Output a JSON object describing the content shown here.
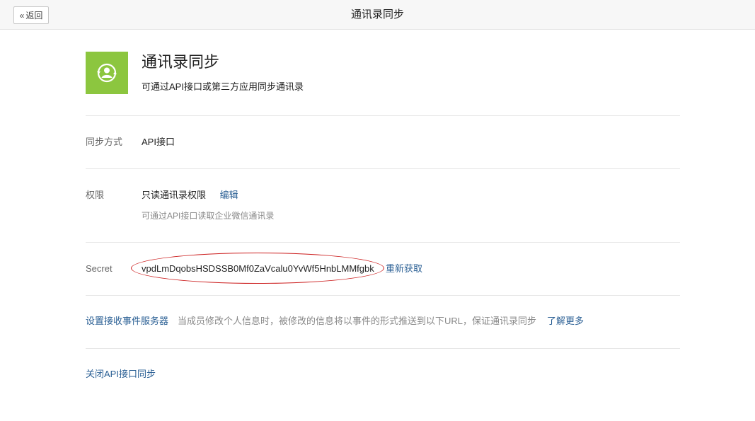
{
  "header": {
    "back_label": "返回",
    "title": "通讯录同步"
  },
  "app": {
    "icon": "contacts-sync-icon",
    "icon_color": "#8cc63f",
    "title": "通讯录同步",
    "description": "可通过API接口或第三方应用同步通讯录"
  },
  "sync_method": {
    "label": "同步方式",
    "value": "API接口"
  },
  "permission": {
    "label": "权限",
    "value": "只读通讯录权限",
    "edit_label": "编辑",
    "note": "可通过API接口读取企业微信通讯录"
  },
  "secret": {
    "label": "Secret",
    "value": "vpdLmDqobsHSDSSB0Mf0ZaVcalu0YvWf5HnbLMMfgbk",
    "refresh_label": "重新获取",
    "highlight_color": "#cc1f1f"
  },
  "event_server": {
    "link_label": "设置接收事件服务器",
    "description": "当成员修改个人信息时，被修改的信息将以事件的形式推送到以下URL，保证通讯录同步",
    "more_label": "了解更多"
  },
  "close_sync": {
    "label": "关闭API接口同步"
  },
  "colors": {
    "link": "#2a5f94",
    "muted": "#888888"
  }
}
